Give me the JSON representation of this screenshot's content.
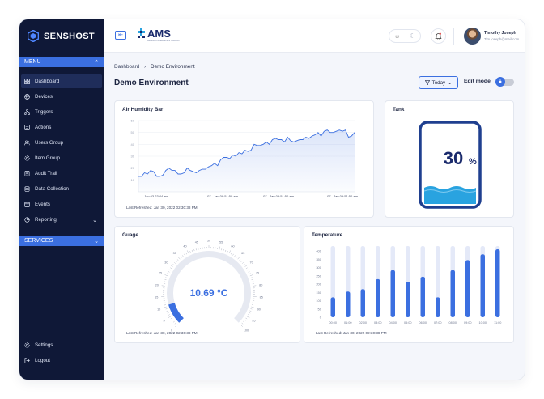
{
  "brand": {
    "name": "SENSHOST"
  },
  "sidebar": {
    "menu_label": "MENU",
    "services_label": "SERVICES",
    "items": [
      {
        "label": "Dashboard"
      },
      {
        "label": "Devices"
      },
      {
        "label": "Triggers"
      },
      {
        "label": "Actions"
      },
      {
        "label": "Users Group"
      },
      {
        "label": "Item Group"
      },
      {
        "label": "Audit Trail"
      },
      {
        "label": "Data Collection"
      },
      {
        "label": "Events"
      },
      {
        "label": "Reporting"
      }
    ],
    "bottom": [
      {
        "label": "Settings"
      },
      {
        "label": "Logout"
      }
    ]
  },
  "topbar": {
    "logo_text": "AMS",
    "logo_subtitle": "Advanced Measurement Solutions",
    "user_name": "Timothy Joseph",
    "user_email": "Tim.joseph@mail.com"
  },
  "breadcrumb": {
    "root": "Dashboard",
    "separator": "›",
    "current": "Demo Environment"
  },
  "page": {
    "title": "Demo Environment",
    "filter_label": "Today",
    "edit_mode_label": "Edit mode"
  },
  "cards": {
    "humidity": {
      "title": "Air Humidity Bar",
      "refreshed": "Last Refreshed: Jan 30, 2022 02:30:38 PM",
      "x_labels": [
        "Jan 03 23:44 am",
        "07 - Jan 09:51:50 am",
        "07 - Jan 09:51:50 am",
        "07 - Jan 09:51:50 am"
      ],
      "y_ticks": [
        "60",
        "50",
        "40",
        "30",
        "20",
        "10"
      ]
    },
    "tank": {
      "title": "Tank",
      "value": "30",
      "unit": "%"
    },
    "gauge": {
      "title": "Guage",
      "value_text": "10.69 °C",
      "refreshed": "Last Refreshed: Jan 30, 2022 02:30:38 PM",
      "scale": [
        "0",
        "5",
        "10",
        "15",
        "20",
        "25",
        "30",
        "35",
        "40",
        "45",
        "50",
        "55",
        "60",
        "65",
        "70",
        "75",
        "80",
        "85",
        "90",
        "95",
        "100"
      ]
    },
    "temperature": {
      "title": "Temperature",
      "refreshed": "Last Refreshed: Jan 30, 2022 02:30:38 PM"
    }
  },
  "colors": {
    "accent": "#3b6fe0",
    "sidebar": "#0f1837",
    "bar_track": "#e4e9f8",
    "tank_fill": "#29a3e0",
    "tank_border": "#1f3f8f"
  },
  "chart_data": [
    {
      "type": "area",
      "title": "Air Humidity Bar",
      "xlabel": "",
      "ylabel": "",
      "ylim": [
        0,
        60
      ],
      "y": [
        13,
        13,
        16,
        15,
        18,
        17,
        13,
        13,
        14,
        18,
        20,
        18,
        18,
        15,
        15,
        16,
        20,
        18,
        17,
        16,
        18,
        19,
        19,
        21,
        22,
        24,
        22,
        27,
        29,
        29,
        28,
        31,
        30,
        33,
        32,
        35,
        34,
        35,
        40,
        39,
        39,
        40,
        42,
        40,
        44,
        45,
        44,
        44,
        42,
        46,
        43,
        42,
        43,
        44,
        44,
        46,
        45,
        47,
        48,
        50,
        47,
        51,
        52,
        50,
        50,
        51,
        52,
        51,
        52,
        46,
        47,
        50
      ]
    },
    {
      "type": "bar",
      "title": "Temperature",
      "categories": [
        "00:00",
        "01:00",
        "02:00",
        "03:00",
        "04:00",
        "05:00",
        "06:00",
        "07:00",
        "08:00",
        "09:00",
        "10:00",
        "11:00"
      ],
      "values": [
        120,
        155,
        170,
        230,
        285,
        215,
        245,
        120,
        285,
        345,
        380,
        410
      ],
      "ylim": [
        0,
        420
      ],
      "y_ticks": [
        0,
        50,
        100,
        150,
        200,
        250,
        300,
        350,
        400
      ]
    },
    {
      "type": "gauge",
      "title": "Guage",
      "value": 10.69,
      "range": [
        0,
        100
      ],
      "unit": "°C"
    },
    {
      "type": "tank",
      "title": "Tank",
      "value": 30,
      "unit": "%"
    }
  ]
}
